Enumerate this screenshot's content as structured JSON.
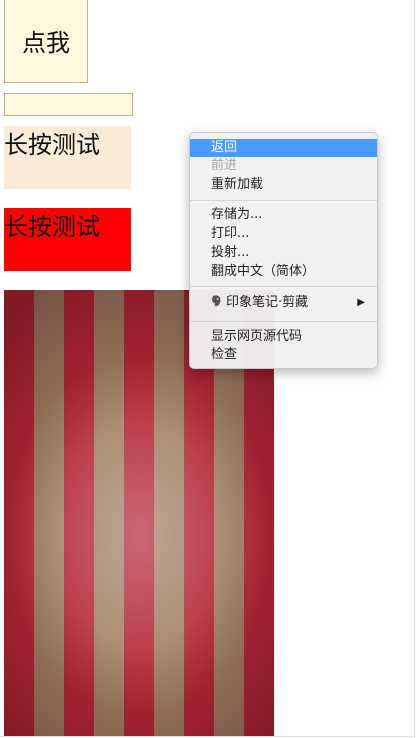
{
  "page": {
    "click_button": "点我",
    "input_value": "",
    "longpress_1": "长按测试",
    "longpress_2": "长按测试"
  },
  "colors": {
    "button_bg": "#fff8dc",
    "longpress_1_bg": "#f9ebd8",
    "longpress_2_bg": "#ff0000",
    "menu_highlight": "#4a9bf7",
    "stripe_red": "#b42737",
    "stripe_tan": "#a08064"
  },
  "context_menu": {
    "back": "返回",
    "forward": "前进",
    "reload": "重新加载",
    "save_as": "存储为...",
    "print": "打印...",
    "cast": "投射...",
    "translate": "翻成中文（简体）",
    "evernote_clip": "印象笔记·剪藏",
    "view_source": "显示网页源代码",
    "inspect": "检查",
    "submenu_arrow_icon": "triangle-right-icon",
    "evernote_icon": "elephant-icon"
  }
}
